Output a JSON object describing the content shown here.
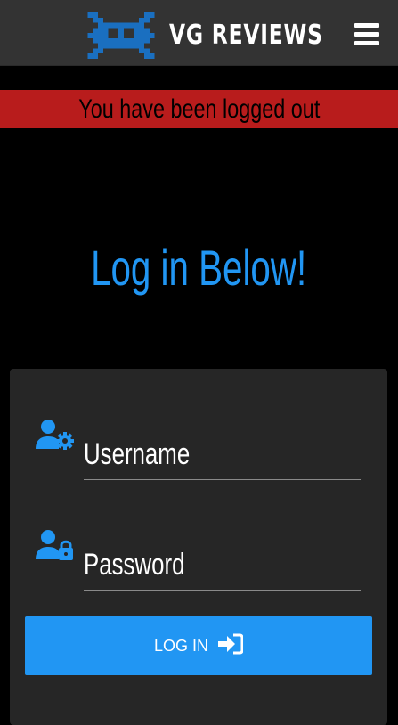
{
  "header": {
    "brand": "VG REVIEWS",
    "logo_icon": "space-invader-icon",
    "menu_icon": "hamburger-menu-icon"
  },
  "alert": {
    "message": "You have been logged out",
    "color": "#b81c1c"
  },
  "page": {
    "title": "Log in Below!"
  },
  "login_form": {
    "username_placeholder": "Username",
    "username_icon": "user-gear-icon",
    "password_placeholder": "Password",
    "password_icon": "user-lock-icon",
    "submit_label": "LOG IN",
    "submit_icon": "sign-in-icon"
  },
  "colors": {
    "accent": "#2196f3",
    "header_bg": "#333333",
    "card_bg": "#262626",
    "page_bg": "#000000"
  }
}
